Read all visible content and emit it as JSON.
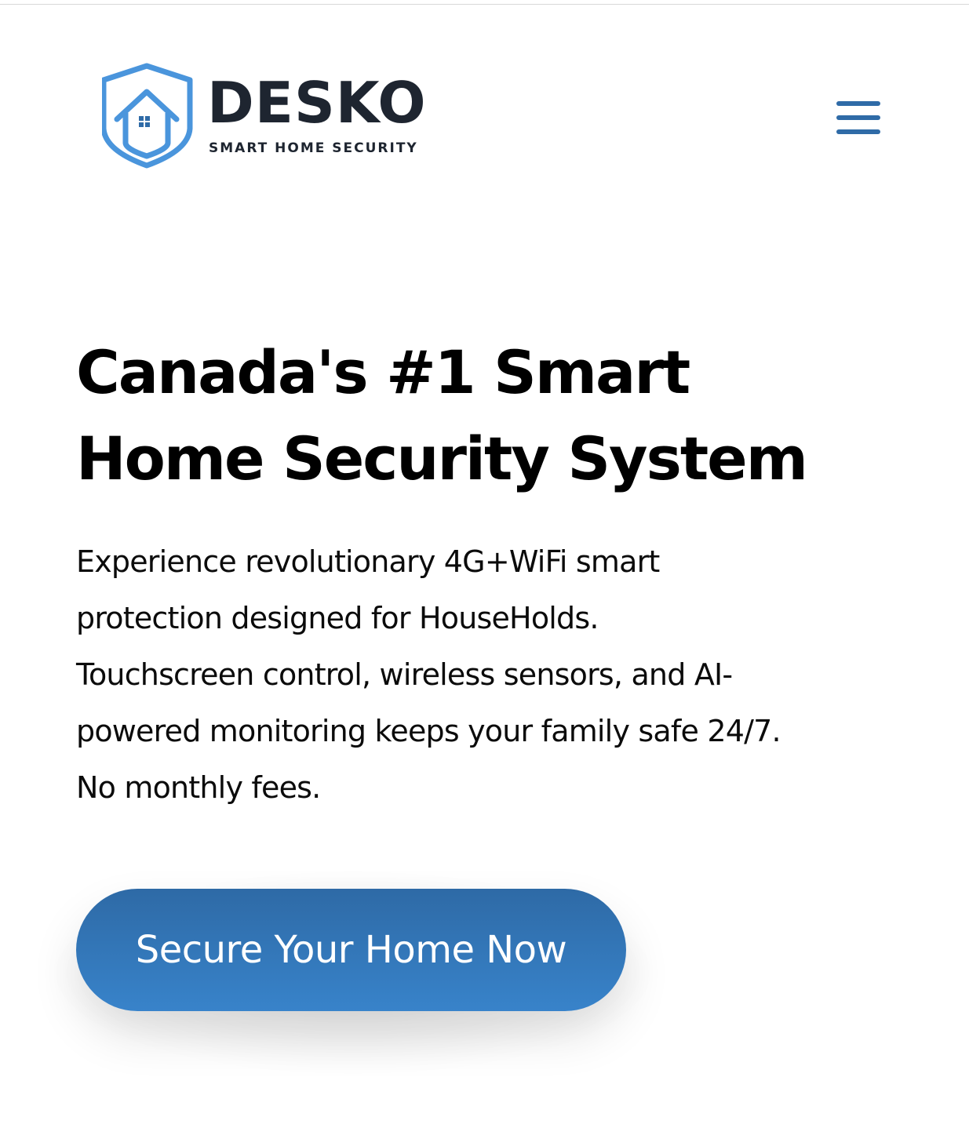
{
  "brand": {
    "name": "DESKO",
    "tagline": "SMART HOME SECURITY",
    "colors": {
      "shield": "#4a95dc",
      "text": "#1e2530",
      "accent": "#2f6ba7"
    }
  },
  "header": {
    "menu_icon": "hamburger-menu-icon"
  },
  "hero": {
    "title_line1": "Canada's #1 Smart",
    "title_line2": "Home Security System",
    "desc_line1": "Experience revolutionary 4G+WiFi smart",
    "desc_line2": "protection designed for HouseHolds.",
    "desc_line3": "Touchscreen control, wireless sensors, and AI-",
    "desc_line4": "powered monitoring keeps your family safe 24/7.",
    "desc_line5": "No monthly fees.",
    "cta_label": "Secure Your Home Now",
    "cta_color": "#3378bb"
  }
}
